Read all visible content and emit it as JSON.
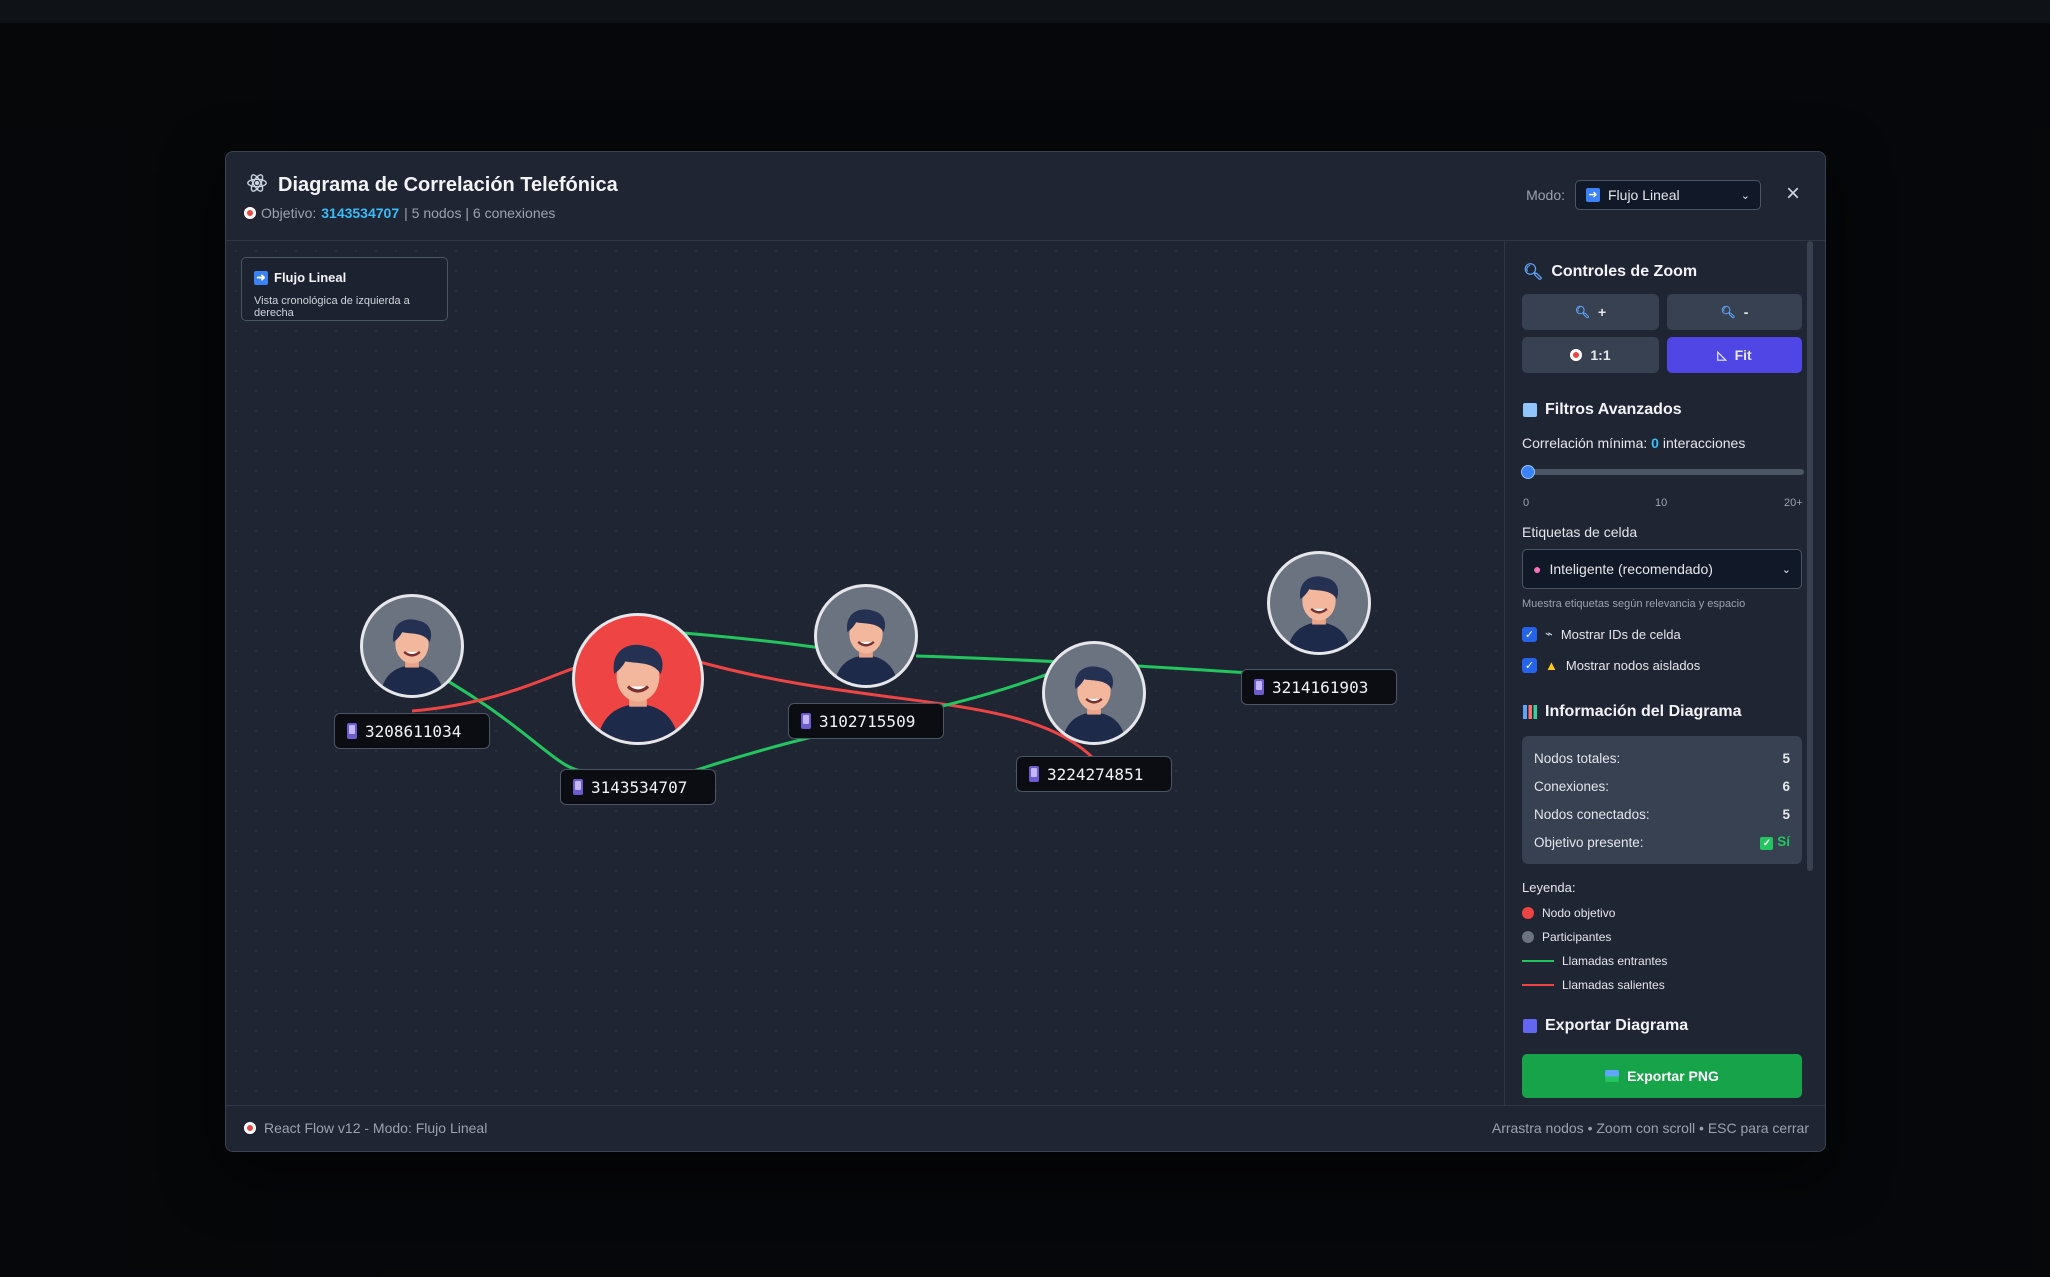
{
  "modal": {
    "title": "Diagrama de Correlación Telefónica",
    "subtitle": {
      "prefix": "Objetivo:",
      "target": "3143534707",
      "stats": "| 5 nodos | 6 conexiones"
    },
    "mode_label": "Modo:",
    "mode_value": "Flujo Lineal",
    "close_label": "×"
  },
  "canvas": {
    "info_title": "Flujo Lineal",
    "info_desc": "Vista cronológica de izquierda a derecha",
    "nodes": [
      {
        "phone": "3208611034",
        "type": "participant"
      },
      {
        "phone": "3143534707",
        "type": "target"
      },
      {
        "phone": "3102715509",
        "type": "participant"
      },
      {
        "phone": "3224274851",
        "type": "participant"
      },
      {
        "phone": "3214161903",
        "type": "participant"
      }
    ],
    "colors": {
      "incoming": "#22c55e",
      "outgoing": "#ef4444",
      "target": "#ef4444",
      "participant": "#6b7280"
    }
  },
  "panel": {
    "zoom_title": "Controles de Zoom",
    "zoom_in": "+",
    "zoom_out": "-",
    "zoom_reset": "1:1",
    "zoom_fit": "Fit",
    "filters_title": "Filtros Avanzados",
    "corr_label_prefix": "Correlación mínima:",
    "corr_value": "0",
    "corr_label_suffix": "interacciones",
    "slider_value": 0,
    "slider_ticks": [
      "0",
      "10",
      "20+"
    ],
    "cell_labels_title": "Etiquetas de celda",
    "cell_labels_value": "Inteligente (recomendado)",
    "cell_labels_help": "Muestra etiquetas según relevancia y espacio",
    "show_cell_ids": "Mostrar IDs de celda",
    "show_isolated": "Mostrar nodos aislados",
    "info_title": "Información del Diagrama",
    "stats": {
      "total_nodes_label": "Nodos totales:",
      "total_nodes": "5",
      "connections_label": "Conexiones:",
      "connections": "6",
      "connected_label": "Nodos conectados:",
      "connected": "5",
      "target_label": "Objetivo presente:",
      "target_present": "Sí"
    },
    "legend_title": "Leyenda:",
    "legend": {
      "target": "Nodo objetivo",
      "participants": "Participantes",
      "incoming": "Llamadas entrantes",
      "outgoing": "Llamadas salientes"
    },
    "export_title": "Exportar Diagrama",
    "export_png": "Exportar PNG"
  },
  "footer": {
    "left": "React Flow v12 - Modo: Flujo Lineal",
    "right": "Arrastra nodos • Zoom con scroll • ESC para cerrar"
  }
}
